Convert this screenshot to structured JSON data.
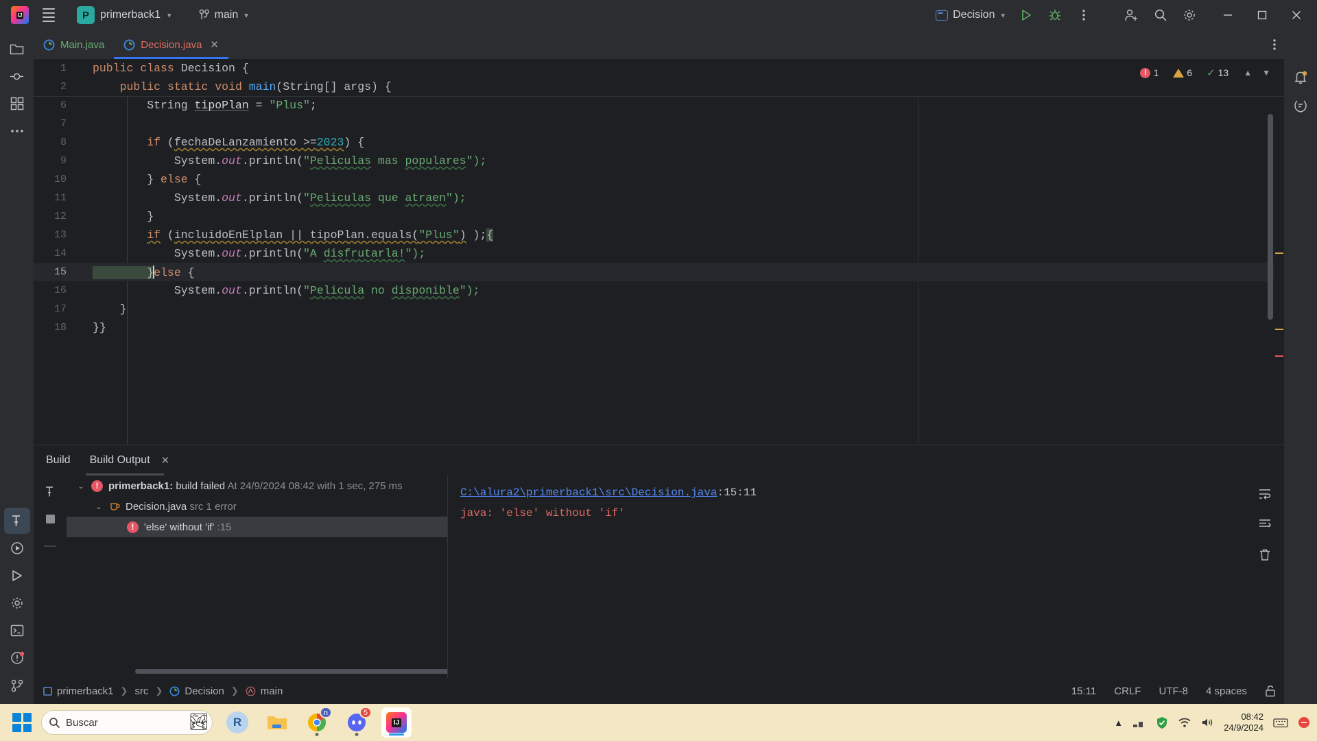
{
  "titlebar": {
    "menu_icon": "hamburger-menu-icon",
    "project_badge": "P",
    "project_name": "primerback1",
    "branch_icon": "git-branch-icon",
    "branch_name": "main",
    "run_config": "Decision",
    "run_icon": "run-play-icon",
    "debug_icon": "debug-bug-icon",
    "more_icon": "more-vertical-icon",
    "account_icon": "account-add-icon",
    "search_icon": "search-icon",
    "settings_icon": "gear-icon",
    "minimize": "minimize-icon",
    "maximize": "maximize-icon",
    "close": "close-icon"
  },
  "left_rail": {
    "items": [
      {
        "name": "project-tool-icon",
        "glyph": "folder"
      },
      {
        "name": "commit-tool-icon",
        "glyph": "commit"
      },
      {
        "name": "structure-tool-icon",
        "glyph": "grid"
      },
      {
        "name": "more-tool-windows-icon",
        "glyph": "dots"
      }
    ],
    "bottom_items": [
      {
        "name": "build-tool-icon",
        "glyph": "hammer"
      },
      {
        "name": "run-tool-icon",
        "glyph": "play-circle"
      },
      {
        "name": "services-tool-icon",
        "glyph": "play"
      },
      {
        "name": "settings-tool-icon",
        "glyph": "gear"
      },
      {
        "name": "terminal-tool-icon",
        "glyph": "terminal"
      },
      {
        "name": "problems-tool-icon",
        "glyph": "error"
      },
      {
        "name": "version-control-tool-icon",
        "glyph": "vcs"
      }
    ]
  },
  "right_rail": {
    "items": [
      {
        "name": "notifications-icon",
        "glyph": "bell"
      },
      {
        "name": "ai-assistant-icon",
        "glyph": "ai"
      }
    ]
  },
  "tabs": [
    {
      "label": "Main.java",
      "icon": "java-class-icon",
      "active": false,
      "closable": false
    },
    {
      "label": "Decision.java",
      "icon": "java-class-icon",
      "active": true,
      "closable": true
    }
  ],
  "editor": {
    "sticky_lines": [
      {
        "no": "1",
        "tokens": [
          {
            "t": "public",
            "c": "kw"
          },
          {
            "t": " ",
            "c": "pl"
          },
          {
            "t": "class",
            "c": "kw"
          },
          {
            "t": " ",
            "c": "pl"
          },
          {
            "t": "Decision",
            "c": "pl"
          },
          {
            "t": " {",
            "c": "pl"
          }
        ]
      },
      {
        "no": "2",
        "tokens": [
          {
            "t": "    ",
            "c": "pl"
          },
          {
            "t": "public",
            "c": "kw"
          },
          {
            "t": " ",
            "c": "pl"
          },
          {
            "t": "static",
            "c": "kw"
          },
          {
            "t": " ",
            "c": "pl"
          },
          {
            "t": "void",
            "c": "kw"
          },
          {
            "t": " ",
            "c": "pl"
          },
          {
            "t": "main",
            "c": "fn"
          },
          {
            "t": "(String[] args) {",
            "c": "pl"
          }
        ]
      }
    ],
    "lines": [
      {
        "no": "6",
        "tokens": [
          {
            "t": "        String ",
            "c": "pl"
          },
          {
            "t": "tipoPlan",
            "c": "grey-u"
          },
          {
            "t": " = ",
            "c": "pl"
          },
          {
            "t": "\"Plus\"",
            "c": "str"
          },
          {
            "t": ";",
            "c": "pl"
          }
        ]
      },
      {
        "no": "7",
        "tokens": []
      },
      {
        "no": "8",
        "tokens": [
          {
            "t": "        ",
            "c": "pl"
          },
          {
            "t": "if",
            "c": "kw"
          },
          {
            "t": " (",
            "c": "pl"
          },
          {
            "t": "fechaDeLanzamiento >=",
            "c": "pl warn-u"
          },
          {
            "t": "2023",
            "c": "num warn-u"
          },
          {
            "t": ") {",
            "c": "pl"
          }
        ]
      },
      {
        "no": "9",
        "tokens": [
          {
            "t": "            System.",
            "c": "pl"
          },
          {
            "t": "out",
            "c": "fld"
          },
          {
            "t": ".println(",
            "c": "pl"
          },
          {
            "t": "\"",
            "c": "str"
          },
          {
            "t": "Peliculas",
            "c": "str typo-u"
          },
          {
            "t": " mas ",
            "c": "str"
          },
          {
            "t": "populares",
            "c": "str typo-u"
          },
          {
            "t": "\");",
            "c": "str"
          }
        ]
      },
      {
        "no": "10",
        "tokens": [
          {
            "t": "        } ",
            "c": "pl"
          },
          {
            "t": "else",
            "c": "kw"
          },
          {
            "t": " {",
            "c": "pl"
          }
        ]
      },
      {
        "no": "11",
        "tokens": [
          {
            "t": "            System.",
            "c": "pl"
          },
          {
            "t": "out",
            "c": "fld"
          },
          {
            "t": ".println(",
            "c": "pl"
          },
          {
            "t": "\"",
            "c": "str"
          },
          {
            "t": "Peliculas",
            "c": "str typo-u"
          },
          {
            "t": " que ",
            "c": "str"
          },
          {
            "t": "atraen",
            "c": "str typo-u"
          },
          {
            "t": "\");",
            "c": "str"
          }
        ]
      },
      {
        "no": "12",
        "tokens": [
          {
            "t": "        }",
            "c": "pl"
          }
        ]
      },
      {
        "no": "13",
        "tokens": [
          {
            "t": "        ",
            "c": "pl"
          },
          {
            "t": "if",
            "c": "kw warn-u"
          },
          {
            "t": " (",
            "c": "pl"
          },
          {
            "t": "incluidoEnElplan || tipoPlan.equals(",
            "c": "pl warn-u"
          },
          {
            "t": "\"Plus\"",
            "c": "str warn-u"
          },
          {
            "t": ")",
            "c": "pl warn-u"
          },
          {
            "t": " );",
            "c": "pl"
          },
          {
            "t": "{",
            "c": "pl brace-hl"
          }
        ]
      },
      {
        "no": "14",
        "tokens": [
          {
            "t": "            System.",
            "c": "pl"
          },
          {
            "t": "out",
            "c": "fld"
          },
          {
            "t": ".println(",
            "c": "pl"
          },
          {
            "t": "\"A ",
            "c": "str"
          },
          {
            "t": "disfrutarla!",
            "c": "str typo-u"
          },
          {
            "t": "\");",
            "c": "str"
          }
        ]
      },
      {
        "no": "15",
        "tokens": [
          {
            "t": "        }",
            "c": "pl brace-hl"
          },
          {
            "t": "CARET",
            "c": "caret"
          },
          {
            "t": "else",
            "c": "kw"
          },
          {
            "t": " {",
            "c": "pl"
          }
        ],
        "current": true
      },
      {
        "no": "16",
        "tokens": [
          {
            "t": "            System.",
            "c": "pl"
          },
          {
            "t": "out",
            "c": "fld"
          },
          {
            "t": ".println(",
            "c": "pl"
          },
          {
            "t": "\"",
            "c": "str"
          },
          {
            "t": "Pelicula",
            "c": "str typo-u"
          },
          {
            "t": " no ",
            "c": "str"
          },
          {
            "t": "disponible",
            "c": "str typo-u"
          },
          {
            "t": "\");",
            "c": "str"
          }
        ]
      },
      {
        "no": "17",
        "tokens": [
          {
            "t": "    }",
            "c": "pl"
          }
        ]
      },
      {
        "no": "18",
        "tokens": [
          {
            "t": "}}",
            "c": "pl"
          }
        ]
      }
    ],
    "inspection": {
      "error_count": "1",
      "warning_count": "6",
      "ok_count": "13",
      "prev_icon": "chevron-up-icon",
      "next_icon": "chevron-down-icon"
    }
  },
  "build_panel": {
    "title": "Build",
    "tab_label": "Build Output",
    "tab_close": "close-icon",
    "toolbar": [
      {
        "name": "build-icon",
        "glyph": "hammer"
      },
      {
        "name": "stop-icon",
        "glyph": "square"
      },
      {
        "name": "divider",
        "glyph": "line"
      }
    ],
    "tree": [
      {
        "level": 0,
        "chevron": "⌄",
        "icon": "error-icon",
        "strong": "primerback1:",
        "label": " build failed ",
        "dim": "At 24/9/2024 08:42 with 1 sec, 275 ms",
        "selected": false
      },
      {
        "level": 1,
        "chevron": "⌄",
        "icon": "java-file-icon",
        "strong": "",
        "label": "Decision.java",
        "dim": "src 1 error",
        "selected": false
      },
      {
        "level": 2,
        "chevron": "",
        "icon": "error-icon",
        "strong": "",
        "label": "'else' without 'if'",
        "dim": ":15",
        "selected": true
      }
    ],
    "output": {
      "link": "C:\\alura2\\primerback1\\src\\Decision.java",
      "link_suffix": ":15:11",
      "error_text": "java: 'else' without 'if'"
    },
    "right_icons": [
      {
        "name": "soft-wrap-icon",
        "glyph": "wrap"
      },
      {
        "name": "scroll-to-end-icon",
        "glyph": "scrollend"
      },
      {
        "name": "clear-all-icon",
        "glyph": "trash"
      }
    ]
  },
  "status_bar": {
    "breadcrumb": [
      {
        "label": "primerback1",
        "icon": "module-icon"
      },
      {
        "label": "src",
        "icon": ""
      },
      {
        "label": "Decision",
        "icon": "java-class-icon"
      },
      {
        "label": "main",
        "icon": "method-icon"
      }
    ],
    "caret_position": "15:11",
    "line_separator": "CRLF",
    "encoding": "UTF-8",
    "indent": "4 spaces",
    "lock_icon": "unlock-icon"
  },
  "taskbar": {
    "start_icon": "windows-start-icon",
    "search_placeholder": "Buscar",
    "search_icon": "search-icon",
    "apps": [
      {
        "name": "taskbar-app-r",
        "label": "R",
        "badge": "",
        "running": false
      },
      {
        "name": "taskbar-app-explorer",
        "label": "",
        "badge": "",
        "running": false
      },
      {
        "name": "taskbar-app-chrome",
        "label": "",
        "badge": "n",
        "running": true
      },
      {
        "name": "taskbar-app-discord",
        "label": "",
        "badge": "5",
        "running": true
      },
      {
        "name": "taskbar-app-intellij",
        "label": "IJ",
        "badge": "",
        "running": true
      }
    ],
    "tray": {
      "chevron": "chevron-up-icon",
      "network_icon": "network-icon",
      "shield_icon": "security-icon",
      "wifi_icon": "wifi-icon",
      "volume_icon": "volume-icon",
      "battery_icon": "battery-icon",
      "time": "08:42",
      "date": "24/9/2024",
      "keyboard_icon": "keyboard-icon",
      "notify_icon": "notification-icon"
    }
  },
  "colors": {
    "accent": "#3574f0",
    "error": "#e55765",
    "warning": "#d9a343",
    "ok": "#5fad65",
    "link": "#548af7"
  }
}
